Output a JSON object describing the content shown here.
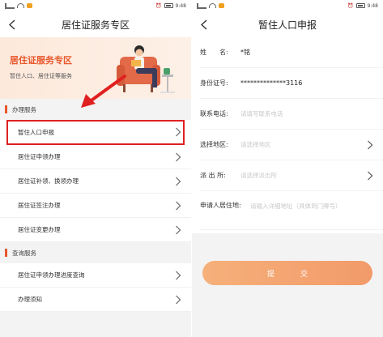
{
  "left": {
    "status": {
      "time": "9:48"
    },
    "nav": {
      "title": "居住证服务专区"
    },
    "banner": {
      "title": "居住证服务专区",
      "subtitle": "暂住人口、居住证等服务"
    },
    "sections": [
      {
        "title": "办理服务",
        "items": [
          "暂住人口申报",
          "居住证申领办理",
          "居住证补领、换领办理",
          "居住证签注办理",
          "居住证变更办理"
        ]
      },
      {
        "title": "查询服务",
        "items": [
          "居住证申领办理进度查询",
          "办理须知"
        ]
      }
    ]
  },
  "right": {
    "status": {
      "time": "9:48"
    },
    "nav": {
      "title": "暂住人口申报"
    },
    "form": {
      "name_label": "姓　　名:",
      "name_value": "*铭",
      "id_label": "身份证号:",
      "id_value": "**************3116",
      "phone_label": "联系电话:",
      "phone_placeholder": "请填写联系电话",
      "area_label": "选择地区:",
      "area_placeholder": "请选择地区",
      "station_label": "派 出 所:",
      "station_placeholder": "请选择派出所",
      "address_label": "申请人居住地:",
      "address_placeholder": "请输入详细地址（具体到门牌号）"
    },
    "submit_label": "提交"
  },
  "colors": {
    "accent": "#e8572b",
    "highlight": "#e02020",
    "submit": "#f4a673"
  }
}
